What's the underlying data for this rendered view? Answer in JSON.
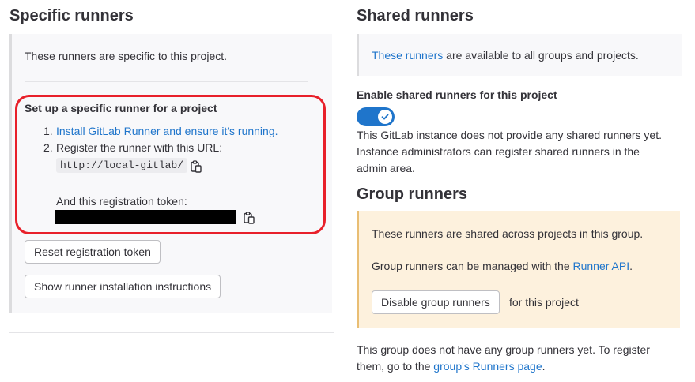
{
  "specific": {
    "heading": "Specific runners",
    "intro": "These runners are specific to this project.",
    "setup_title": "Set up a specific runner for a project",
    "step1_num": "1.",
    "step1_link": "Install GitLab Runner and ensure it's running.",
    "step2_num": "2.",
    "step2_text": "Register the runner with this URL:",
    "url": "http://local-gitlab/",
    "token_label": "And this registration token:",
    "reset_button": "Reset registration token",
    "instructions_button": "Show runner installation instructions"
  },
  "shared": {
    "heading": "Shared runners",
    "intro_link": "These runners",
    "intro_rest": " are available to all groups and projects.",
    "toggle_label": "Enable shared runners for this project",
    "toggle_on": true,
    "note_line1": "This GitLab instance does not provide any shared runners yet.",
    "note_line2": "Instance administrators can register shared runners in the",
    "note_line3": "admin area."
  },
  "group": {
    "heading": "Group runners",
    "line1": "These runners are shared across projects in this group.",
    "line2_text": "Group runners can be managed with the ",
    "line2_link": "Runner API",
    "line2_end": ".",
    "disable_button": "Disable group runners",
    "disable_suffix": "for this project",
    "footer_line1": "This group does not have any group runners yet. To register",
    "footer_line2_text": "them, go to the ",
    "footer_line2_link": "group's Runners page",
    "footer_line2_end": "."
  },
  "colors": {
    "link": "#1f75cb",
    "highlight_border": "#e8202a",
    "toggle": "#1f75cb",
    "group_panel_bg": "#fdf1dd",
    "group_panel_border": "#e9be74"
  },
  "icons": {
    "copy_url": "clipboard-icon",
    "copy_token": "clipboard-icon",
    "toggle_check": "check-icon"
  }
}
